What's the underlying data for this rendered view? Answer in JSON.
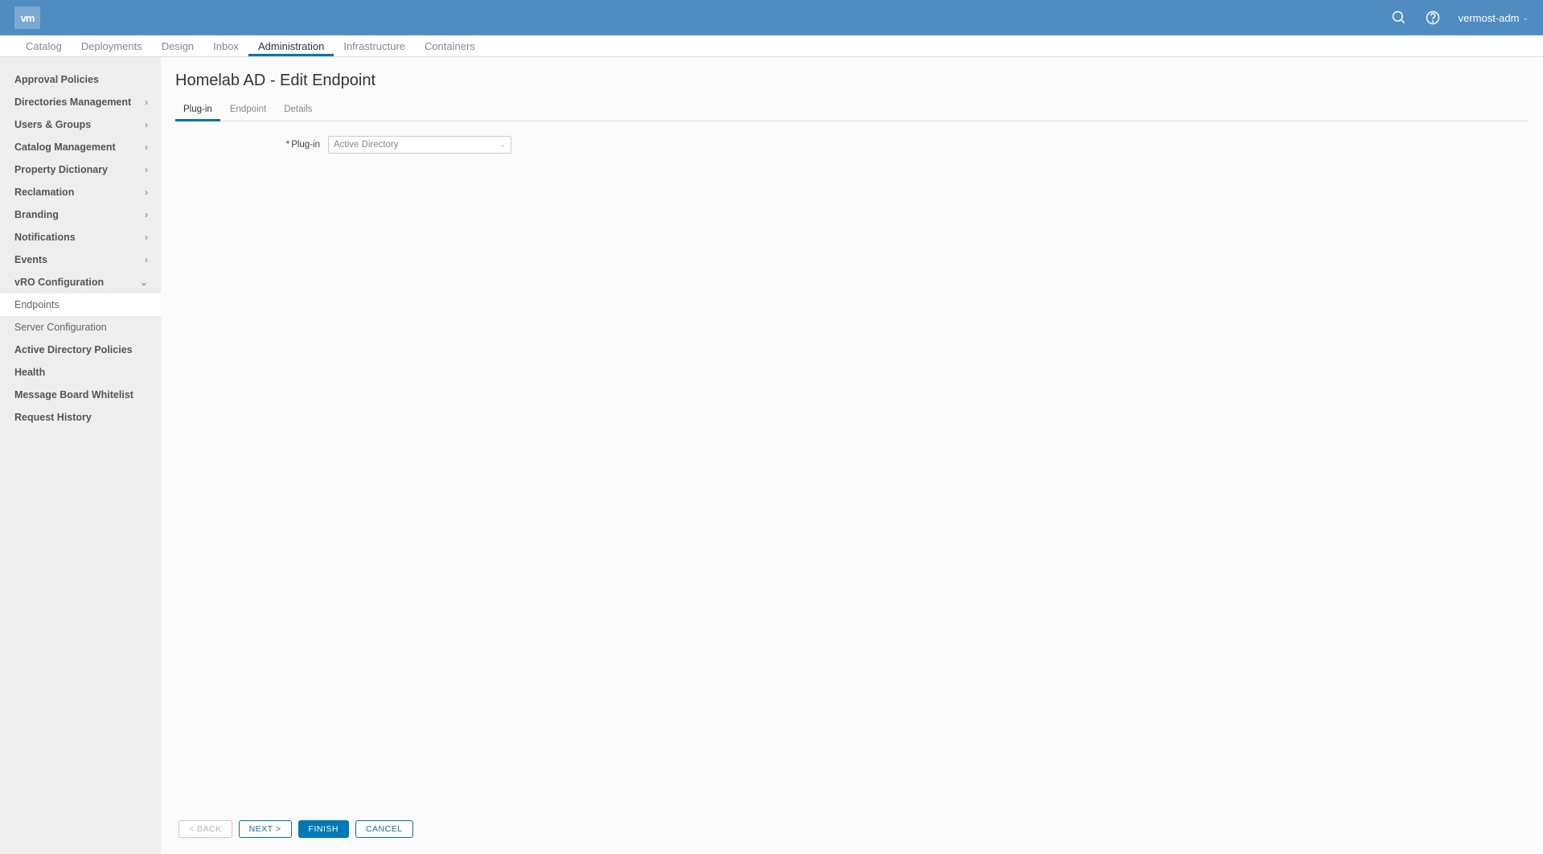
{
  "header": {
    "logo_text": "vm",
    "user_label": "vermost-adm"
  },
  "topnav": {
    "items": [
      {
        "label": "Catalog",
        "active": false
      },
      {
        "label": "Deployments",
        "active": false
      },
      {
        "label": "Design",
        "active": false
      },
      {
        "label": "Inbox",
        "active": false
      },
      {
        "label": "Administration",
        "active": true
      },
      {
        "label": "Infrastructure",
        "active": false
      },
      {
        "label": "Containers",
        "active": false
      }
    ]
  },
  "sidebar": {
    "items": [
      {
        "label": "Approval Policies",
        "expandable": false
      },
      {
        "label": "Directories Management",
        "expandable": true
      },
      {
        "label": "Users & Groups",
        "expandable": true
      },
      {
        "label": "Catalog Management",
        "expandable": true
      },
      {
        "label": "Property Dictionary",
        "expandable": true
      },
      {
        "label": "Reclamation",
        "expandable": true
      },
      {
        "label": "Branding",
        "expandable": true
      },
      {
        "label": "Notifications",
        "expandable": true
      },
      {
        "label": "Events",
        "expandable": true
      },
      {
        "label": "vRO Configuration",
        "expandable": true,
        "expanded": true,
        "children": [
          {
            "label": "Endpoints",
            "active": true
          },
          {
            "label": "Server Configuration",
            "active": false
          }
        ]
      },
      {
        "label": "Active Directory Policies",
        "expandable": false
      },
      {
        "label": "Health",
        "expandable": false
      },
      {
        "label": "Message Board Whitelist",
        "expandable": false
      },
      {
        "label": "Request History",
        "expandable": false
      }
    ]
  },
  "page": {
    "title": "Homelab AD - Edit Endpoint",
    "subtabs": [
      {
        "label": "Plug-in",
        "active": true
      },
      {
        "label": "Endpoint",
        "active": false
      },
      {
        "label": "Details",
        "active": false
      }
    ],
    "form": {
      "plugin_label": "Plug-in",
      "plugin_value": "Active Directory"
    },
    "buttons": {
      "back": "< BACK",
      "next": "NEXT >",
      "finish": "FINISH",
      "cancel": "CANCEL"
    }
  }
}
